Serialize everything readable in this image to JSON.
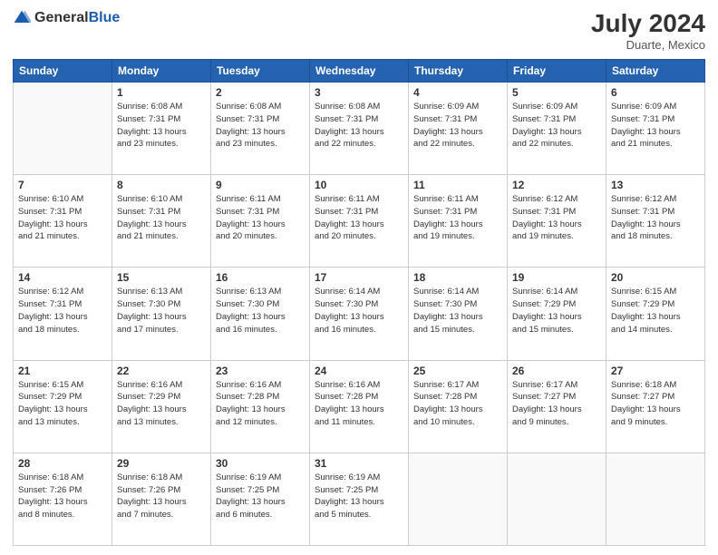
{
  "header": {
    "logo_general": "General",
    "logo_blue": "Blue",
    "month_year": "July 2024",
    "location": "Duarte, Mexico"
  },
  "days_of_week": [
    "Sunday",
    "Monday",
    "Tuesday",
    "Wednesday",
    "Thursday",
    "Friday",
    "Saturday"
  ],
  "weeks": [
    [
      {
        "day": "",
        "info": ""
      },
      {
        "day": "1",
        "info": "Sunrise: 6:08 AM\nSunset: 7:31 PM\nDaylight: 13 hours\nand 23 minutes."
      },
      {
        "day": "2",
        "info": "Sunrise: 6:08 AM\nSunset: 7:31 PM\nDaylight: 13 hours\nand 23 minutes."
      },
      {
        "day": "3",
        "info": "Sunrise: 6:08 AM\nSunset: 7:31 PM\nDaylight: 13 hours\nand 22 minutes."
      },
      {
        "day": "4",
        "info": "Sunrise: 6:09 AM\nSunset: 7:31 PM\nDaylight: 13 hours\nand 22 minutes."
      },
      {
        "day": "5",
        "info": "Sunrise: 6:09 AM\nSunset: 7:31 PM\nDaylight: 13 hours\nand 22 minutes."
      },
      {
        "day": "6",
        "info": "Sunrise: 6:09 AM\nSunset: 7:31 PM\nDaylight: 13 hours\nand 21 minutes."
      }
    ],
    [
      {
        "day": "7",
        "info": "Sunrise: 6:10 AM\nSunset: 7:31 PM\nDaylight: 13 hours\nand 21 minutes."
      },
      {
        "day": "8",
        "info": "Sunrise: 6:10 AM\nSunset: 7:31 PM\nDaylight: 13 hours\nand 21 minutes."
      },
      {
        "day": "9",
        "info": "Sunrise: 6:11 AM\nSunset: 7:31 PM\nDaylight: 13 hours\nand 20 minutes."
      },
      {
        "day": "10",
        "info": "Sunrise: 6:11 AM\nSunset: 7:31 PM\nDaylight: 13 hours\nand 20 minutes."
      },
      {
        "day": "11",
        "info": "Sunrise: 6:11 AM\nSunset: 7:31 PM\nDaylight: 13 hours\nand 19 minutes."
      },
      {
        "day": "12",
        "info": "Sunrise: 6:12 AM\nSunset: 7:31 PM\nDaylight: 13 hours\nand 19 minutes."
      },
      {
        "day": "13",
        "info": "Sunrise: 6:12 AM\nSunset: 7:31 PM\nDaylight: 13 hours\nand 18 minutes."
      }
    ],
    [
      {
        "day": "14",
        "info": "Sunrise: 6:12 AM\nSunset: 7:31 PM\nDaylight: 13 hours\nand 18 minutes."
      },
      {
        "day": "15",
        "info": "Sunrise: 6:13 AM\nSunset: 7:30 PM\nDaylight: 13 hours\nand 17 minutes."
      },
      {
        "day": "16",
        "info": "Sunrise: 6:13 AM\nSunset: 7:30 PM\nDaylight: 13 hours\nand 16 minutes."
      },
      {
        "day": "17",
        "info": "Sunrise: 6:14 AM\nSunset: 7:30 PM\nDaylight: 13 hours\nand 16 minutes."
      },
      {
        "day": "18",
        "info": "Sunrise: 6:14 AM\nSunset: 7:30 PM\nDaylight: 13 hours\nand 15 minutes."
      },
      {
        "day": "19",
        "info": "Sunrise: 6:14 AM\nSunset: 7:29 PM\nDaylight: 13 hours\nand 15 minutes."
      },
      {
        "day": "20",
        "info": "Sunrise: 6:15 AM\nSunset: 7:29 PM\nDaylight: 13 hours\nand 14 minutes."
      }
    ],
    [
      {
        "day": "21",
        "info": "Sunrise: 6:15 AM\nSunset: 7:29 PM\nDaylight: 13 hours\nand 13 minutes."
      },
      {
        "day": "22",
        "info": "Sunrise: 6:16 AM\nSunset: 7:29 PM\nDaylight: 13 hours\nand 13 minutes."
      },
      {
        "day": "23",
        "info": "Sunrise: 6:16 AM\nSunset: 7:28 PM\nDaylight: 13 hours\nand 12 minutes."
      },
      {
        "day": "24",
        "info": "Sunrise: 6:16 AM\nSunset: 7:28 PM\nDaylight: 13 hours\nand 11 minutes."
      },
      {
        "day": "25",
        "info": "Sunrise: 6:17 AM\nSunset: 7:28 PM\nDaylight: 13 hours\nand 10 minutes."
      },
      {
        "day": "26",
        "info": "Sunrise: 6:17 AM\nSunset: 7:27 PM\nDaylight: 13 hours\nand 9 minutes."
      },
      {
        "day": "27",
        "info": "Sunrise: 6:18 AM\nSunset: 7:27 PM\nDaylight: 13 hours\nand 9 minutes."
      }
    ],
    [
      {
        "day": "28",
        "info": "Sunrise: 6:18 AM\nSunset: 7:26 PM\nDaylight: 13 hours\nand 8 minutes."
      },
      {
        "day": "29",
        "info": "Sunrise: 6:18 AM\nSunset: 7:26 PM\nDaylight: 13 hours\nand 7 minutes."
      },
      {
        "day": "30",
        "info": "Sunrise: 6:19 AM\nSunset: 7:25 PM\nDaylight: 13 hours\nand 6 minutes."
      },
      {
        "day": "31",
        "info": "Sunrise: 6:19 AM\nSunset: 7:25 PM\nDaylight: 13 hours\nand 5 minutes."
      },
      {
        "day": "",
        "info": ""
      },
      {
        "day": "",
        "info": ""
      },
      {
        "day": "",
        "info": ""
      }
    ]
  ]
}
